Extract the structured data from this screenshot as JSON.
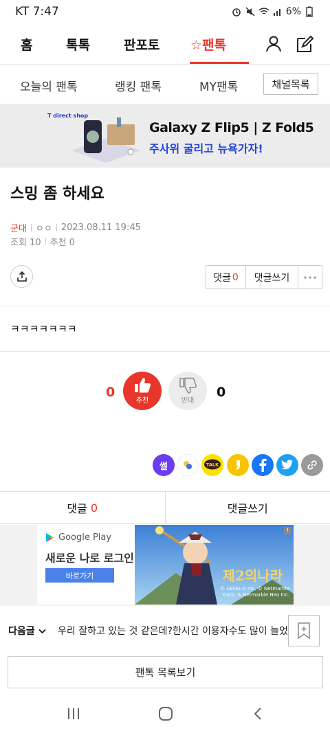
{
  "status_bar": {
    "carrier_time": "KT 7:47",
    "battery": "6%"
  },
  "top_nav": {
    "tabs": [
      {
        "label": "홈"
      },
      {
        "label": "톡톡"
      },
      {
        "label": "판포토"
      },
      {
        "label": "☆팬톡"
      }
    ]
  },
  "sub_nav": {
    "tabs": [
      {
        "label": "오늘의 팬톡"
      },
      {
        "label": "랭킹 팬톡"
      },
      {
        "label": "MY팬톡"
      }
    ],
    "channel_button": "채널목록"
  },
  "banner": {
    "shop": "T direct shop",
    "title": "Galaxy Z Flip5 | Z Fold5",
    "subtitle": "주사위 굴리고 뉴욕가자!"
  },
  "post": {
    "title": "스밍 좀 하세요",
    "author": "군대",
    "nickname": "ㅇㅇ",
    "datetime": "2023.08.11 19:45",
    "views": "조회 10",
    "recommends": "추천 0",
    "content": "ㅋㅋㅋㅋㅋㅋㅋ"
  },
  "actions": {
    "comment_label": "댓글",
    "comment_count": "0",
    "write_comment": "댓글쓰기"
  },
  "vote": {
    "up_count": "0",
    "up_label": "추천",
    "down_count": "0",
    "down_label": "반대"
  },
  "social": [
    "썰",
    "TALK"
  ],
  "comment_bar": {
    "comment_label": "댓글",
    "comment_count": "0",
    "write_comment": "댓글쓰기"
  },
  "ad": {
    "store": "Google Play",
    "title": "새로운 나로 로그인",
    "button": "바로가기",
    "logo": "제2의나라",
    "copyright": "© LEVEL-5 Inc. © Netmarble Corp. & Netmarble Neo Inc."
  },
  "next_post": {
    "label": "다음글",
    "title": "우리 잘하고 있는 것 같은데?한시간 이용자수도 많이 늘었고"
  },
  "list_button": "팬톡 목록보기",
  "colors": {
    "accent": "#e8362b",
    "banner_blue": "#2146d8"
  }
}
